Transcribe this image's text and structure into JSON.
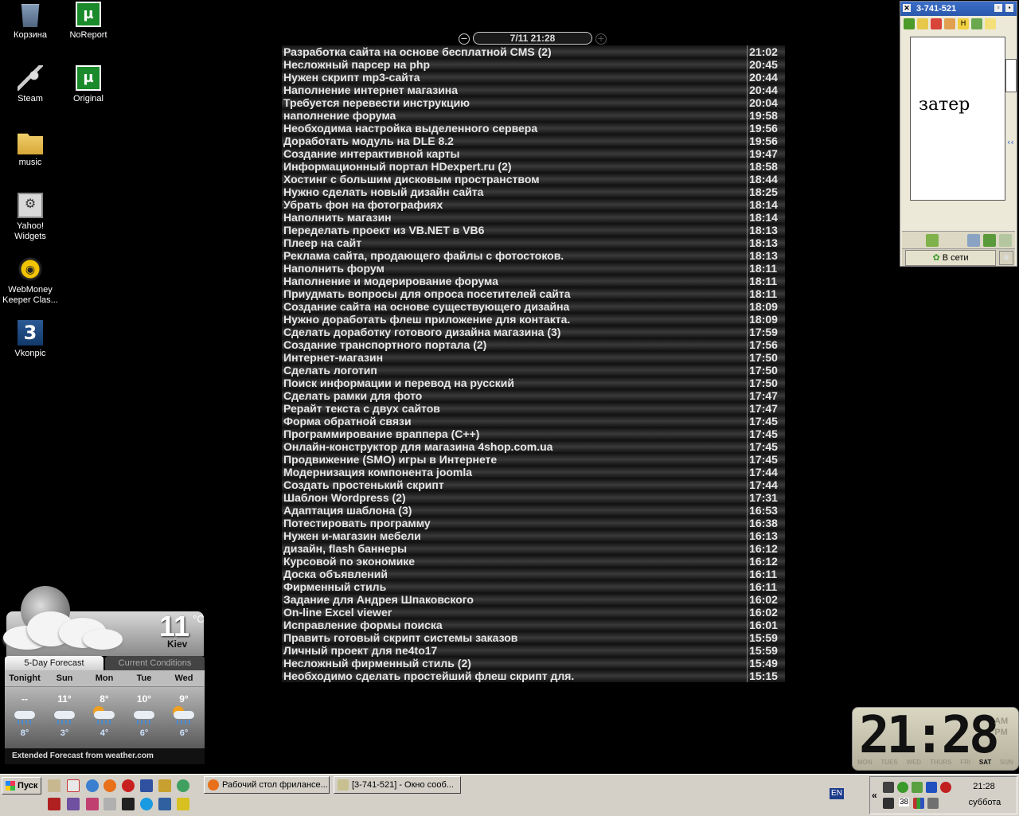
{
  "desktop_icons": [
    {
      "label": "Корзина",
      "icon": "recycle-bin-icon"
    },
    {
      "label": "NoReport",
      "icon": "utorrent-icon"
    },
    {
      "label": "Steam",
      "icon": "steam-icon"
    },
    {
      "label": "Original",
      "icon": "utorrent-icon"
    },
    {
      "label": "music",
      "icon": "folder-icon"
    },
    {
      "label": "Yahoo! Widgets",
      "icon": "yahoo-widgets-icon"
    },
    {
      "label": "WebMoney Keeper Clas...",
      "icon": "webmoney-icon"
    },
    {
      "label": "Vkonpic",
      "icon": "vkonpic-icon"
    }
  ],
  "feed": {
    "date": "7/11 21:28",
    "minus_glyph": "−",
    "plus_glyph": "+",
    "items": [
      {
        "title": "Разработка сайта на основе бесплатной CMS (2)",
        "time": "21:02"
      },
      {
        "title": "Несложный парсер на php",
        "time": "20:45"
      },
      {
        "title": "Нужен скрипт mp3-сайта",
        "time": "20:44"
      },
      {
        "title": "Наполнение интернет магазина",
        "time": "20:44"
      },
      {
        "title": "Требуется перевести инструкцию",
        "time": "20:04"
      },
      {
        "title": "наполнение форума",
        "time": "19:58"
      },
      {
        "title": "Необходима настройка выделенного сервера",
        "time": "19:56"
      },
      {
        "title": "Доработать модуль на DLE 8.2",
        "time": "19:56"
      },
      {
        "title": "Создание интерактивной карты",
        "time": "19:47"
      },
      {
        "title": "Информационный портал HDexpert.ru (2)",
        "time": "18:58"
      },
      {
        "title": "Хостинг с большим дисковым пространством",
        "time": "18:44"
      },
      {
        "title": "Нужно сделать новый дизайн сайта",
        "time": "18:25"
      },
      {
        "title": "Убрать фон на фотографиях",
        "time": "18:14"
      },
      {
        "title": "Наполнить магазин",
        "time": "18:14"
      },
      {
        "title": "Переделать проект из VB.NET в VB6",
        "time": "18:13"
      },
      {
        "title": "Плеер на сайт",
        "time": "18:13"
      },
      {
        "title": "Реклама сайта, продающего файлы с фотостоков.",
        "time": "18:13"
      },
      {
        "title": "Наполнить форум",
        "time": "18:11"
      },
      {
        "title": "Наполнение и модерирование форума",
        "time": "18:11"
      },
      {
        "title": "Приудмать вопросы для опроса посетителей сайта",
        "time": "18:11"
      },
      {
        "title": "Создание сайта на основе существующего дизайна",
        "time": "18:09"
      },
      {
        "title": "Нужно доработать флеш приложение для контакта.",
        "time": "18:09"
      },
      {
        "title": "Сделать доработку готового дизайна магазина (3)",
        "time": "17:59"
      },
      {
        "title": "Создание транспортного портала (2)",
        "time": "17:56"
      },
      {
        "title": "Интернет-магазин",
        "time": "17:50"
      },
      {
        "title": "Сделать логотип",
        "time": "17:50"
      },
      {
        "title": "Поиск информации и перевод на русский",
        "time": "17:50"
      },
      {
        "title": "Сделать рамки для фото",
        "time": "17:47"
      },
      {
        "title": "Рерайт текста с двух сайтов",
        "time": "17:47"
      },
      {
        "title": "Форма обратной связи",
        "time": "17:45"
      },
      {
        "title": "Программирование враппера (C++)",
        "time": "17:45"
      },
      {
        "title": "Онлайн-конструктор для магазина 4shop.com.ua",
        "time": "17:45"
      },
      {
        "title": "Продвижение (SMO) игры в Интернете",
        "time": "17:45"
      },
      {
        "title": "Модернизация компонента joomla",
        "time": "17:44"
      },
      {
        "title": "Создать простенький скрипт",
        "time": "17:44"
      },
      {
        "title": "Шаблон Wordpress (2)",
        "time": "17:31"
      },
      {
        "title": "Адаптация шаблона (3)",
        "time": "16:53"
      },
      {
        "title": "Потестировать программу",
        "time": "16:38"
      },
      {
        "title": "Нужен и-магазин мебели",
        "time": "16:13"
      },
      {
        "title": "дизайн, flash баннеры",
        "time": "16:12"
      },
      {
        "title": "Курсовой по экономике",
        "time": "16:12"
      },
      {
        "title": "Доска объявлений",
        "time": "16:11"
      },
      {
        "title": "Фирменный стиль",
        "time": "16:11"
      },
      {
        "title": "Задание для Андрея Шпаковского",
        "time": "16:02"
      },
      {
        "title": "On-line Excel viewer",
        "time": "16:02"
      },
      {
        "title": "Исправление формы поиска",
        "time": "16:01"
      },
      {
        "title": "Править готовый скрипт системы заказов",
        "time": "15:59"
      },
      {
        "title": "Личный проект для ne4to17",
        "time": "15:59"
      },
      {
        "title": "Несложный фирменный стиль (2)",
        "time": "15:49"
      },
      {
        "title": "Необходимо сделать простейший флеш скрипт для.",
        "time": "15:15"
      }
    ]
  },
  "messenger": {
    "title": "3-741-521",
    "close_glyph": "✕",
    "pane_text": "затер",
    "side_glyph": "‹‹",
    "status": "В сети"
  },
  "weather": {
    "temperature": "11",
    "degree_unit": "°C",
    "city": "Kiev",
    "tabs": [
      "5-Day Forecast",
      "Current Conditions"
    ],
    "days": [
      {
        "name": "Tonight",
        "high": "--",
        "low": "8°",
        "icon": "rain"
      },
      {
        "name": "Sun",
        "high": "11°",
        "low": "3°",
        "icon": "rain"
      },
      {
        "name": "Mon",
        "high": "8°",
        "low": "4°",
        "icon": "sun-rain"
      },
      {
        "name": "Tue",
        "high": "10°",
        "low": "6°",
        "icon": "rain"
      },
      {
        "name": "Wed",
        "high": "9°",
        "low": "6°",
        "icon": "sun-rain"
      }
    ],
    "footer": "Extended Forecast from weather.com"
  },
  "clock": {
    "time": "21:28",
    "am": "AM",
    "pm": "PM",
    "days": [
      "MON",
      "TUES",
      "WED",
      "THURS",
      "FRI",
      "SAT",
      "SUN"
    ],
    "active_day": "SAT"
  },
  "taskbar": {
    "start_label": "Пуск",
    "windows": [
      {
        "label": "Рабочий стол фрилансе...",
        "icon": "firefox-icon"
      },
      {
        "label": "[3-741-521] - Окно сооб...",
        "icon": "chat-window-icon"
      }
    ],
    "language": "EN",
    "tray_count": "38",
    "time": "21:28",
    "weekday": "суббота"
  },
  "colors": {
    "desktop": "#000000",
    "taskbar": "#d4d0c8",
    "qip_title": "#2a58ac"
  }
}
